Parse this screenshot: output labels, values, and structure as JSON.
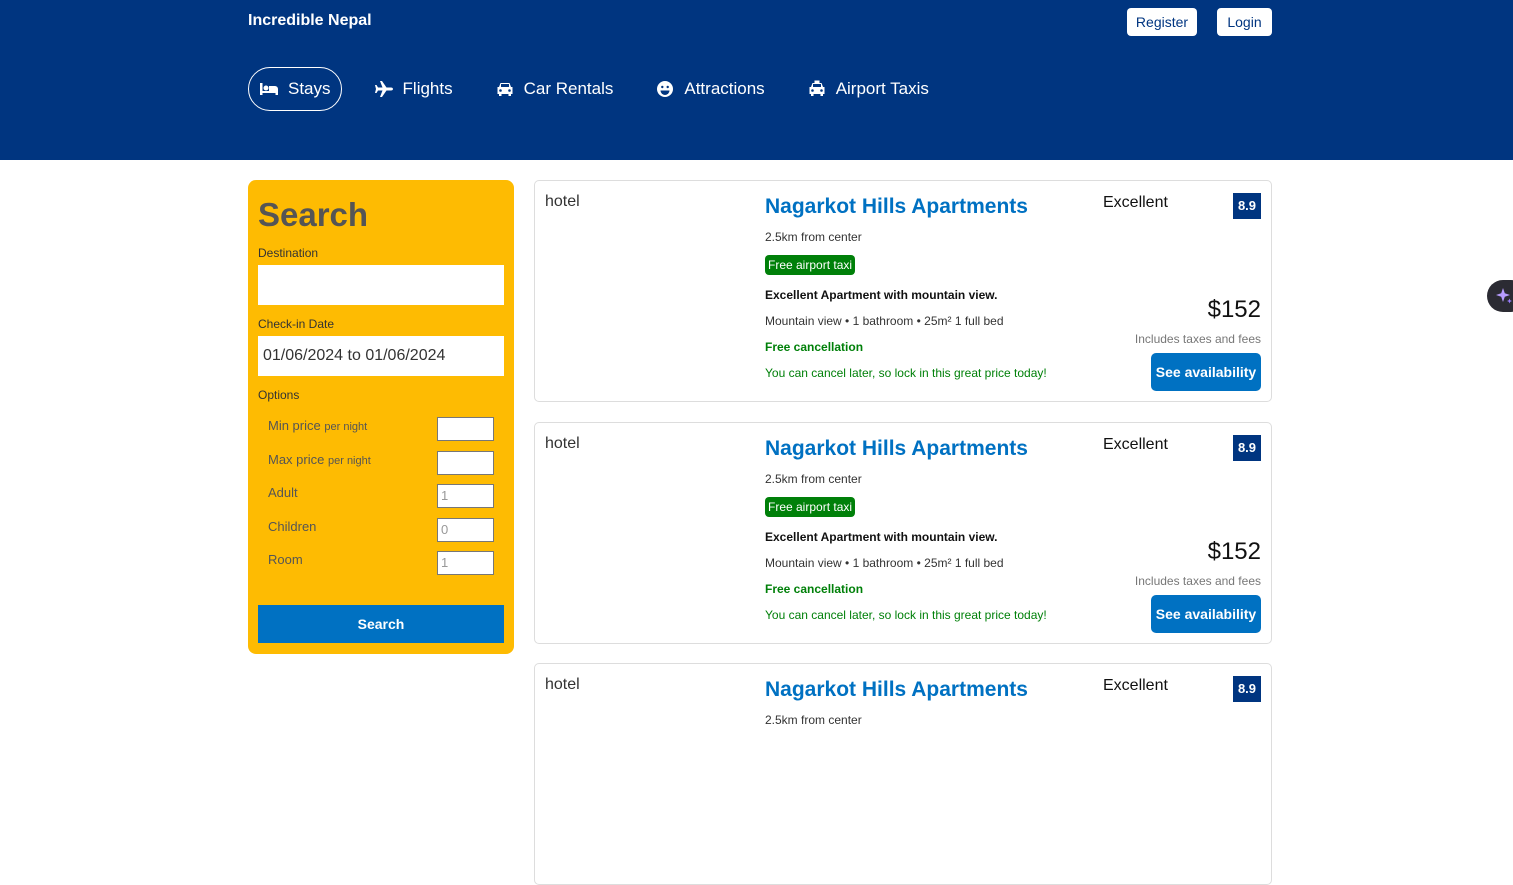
{
  "header": {
    "logo": "Incredible Nepal",
    "register_label": "Register",
    "login_label": "Login",
    "nav": [
      {
        "label": "Stays",
        "icon": "bed-icon"
      },
      {
        "label": "Flights",
        "icon": "plane-icon"
      },
      {
        "label": "Car Rentals",
        "icon": "car-icon"
      },
      {
        "label": "Attractions",
        "icon": "smile-icon"
      },
      {
        "label": "Airport Taxis",
        "icon": "taxi-icon"
      }
    ]
  },
  "search": {
    "title": "Search",
    "destination_label": "Destination",
    "destination_value": "",
    "checkin_label": "Check-in Date",
    "checkin_value": "01/06/2024 to 01/06/2024",
    "options_label": "Options",
    "options": [
      {
        "label": "Min price",
        "suffix": "per night",
        "value": ""
      },
      {
        "label": "Max price",
        "suffix": "per night",
        "value": ""
      },
      {
        "label": "Adult",
        "suffix": "",
        "value": "1"
      },
      {
        "label": "Children",
        "suffix": "",
        "value": "0"
      },
      {
        "label": "Room",
        "suffix": "",
        "value": "1"
      }
    ],
    "button_label": "Search"
  },
  "results": [
    {
      "image_alt": "hotel",
      "title": "Nagarkot Hills Apartments",
      "distance": "2.5km from center",
      "taxi_badge": "Free airport taxi",
      "subtitle": "Excellent Apartment with mountain view.",
      "features": "Mountain view • 1 bathroom • 25m² 1 full bed",
      "cancel": "Free cancellation",
      "cancel_sub": "You can cancel later, so lock in this great price today!",
      "rating_text": "Excellent",
      "rating": "8.9",
      "price": "$152",
      "taxes": "Includes taxes and fees",
      "availability_label": "See availability"
    },
    {
      "image_alt": "hotel",
      "title": "Nagarkot Hills Apartments",
      "distance": "2.5km from center",
      "taxi_badge": "Free airport taxi",
      "subtitle": "Excellent Apartment with mountain view.",
      "features": "Mountain view • 1 bathroom • 25m² 1 full bed",
      "cancel": "Free cancellation",
      "cancel_sub": "You can cancel later, so lock in this great price today!",
      "rating_text": "Excellent",
      "rating": "8.9",
      "price": "$152",
      "taxes": "Includes taxes and fees",
      "availability_label": "See availability"
    },
    {
      "image_alt": "hotel",
      "title": "Nagarkot Hills Apartments",
      "distance": "2.5km from center",
      "rating_text": "Excellent",
      "rating": "8.9"
    }
  ],
  "colors": {
    "header_bg": "#003580",
    "search_bg": "#febb02",
    "accent": "#0071c2",
    "green": "#008009"
  }
}
